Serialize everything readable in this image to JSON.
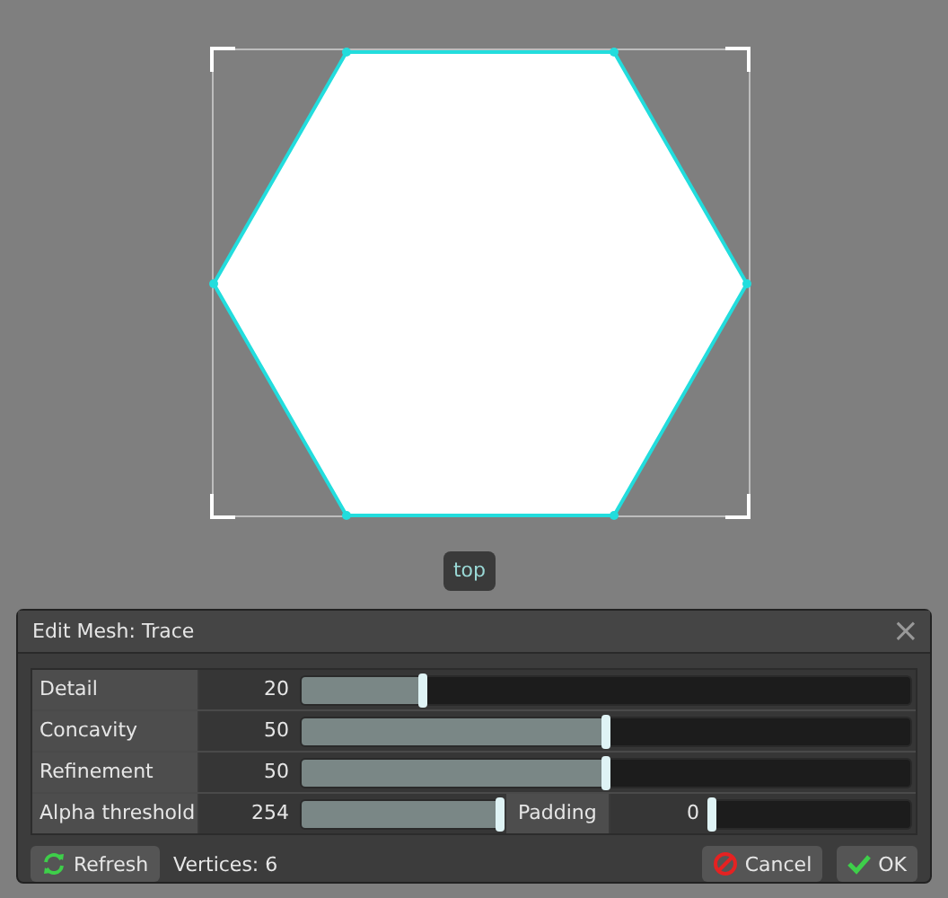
{
  "canvas": {
    "anchor_label": "top"
  },
  "dialog": {
    "title": "Edit Mesh: Trace",
    "close": "×",
    "rows": [
      {
        "fields": [
          {
            "label": "Detail",
            "value": "20",
            "level": 0.2
          }
        ]
      },
      {
        "fields": [
          {
            "label": "Concavity",
            "value": "50",
            "level": 0.5
          }
        ]
      },
      {
        "fields": [
          {
            "label": "Refinement",
            "value": "50",
            "level": 0.5
          }
        ]
      },
      {
        "fields": [
          {
            "label": "Alpha threshold",
            "value": "254",
            "level": 1
          },
          {
            "label": "Padding",
            "value": "0",
            "level": 0
          }
        ]
      }
    ],
    "refresh": "Refresh",
    "vertices": "Vertices: 6",
    "buttons": [
      {
        "kind": "cancel",
        "label": "Cancel"
      },
      {
        "kind": "ok",
        "label": "OK"
      }
    ]
  }
}
